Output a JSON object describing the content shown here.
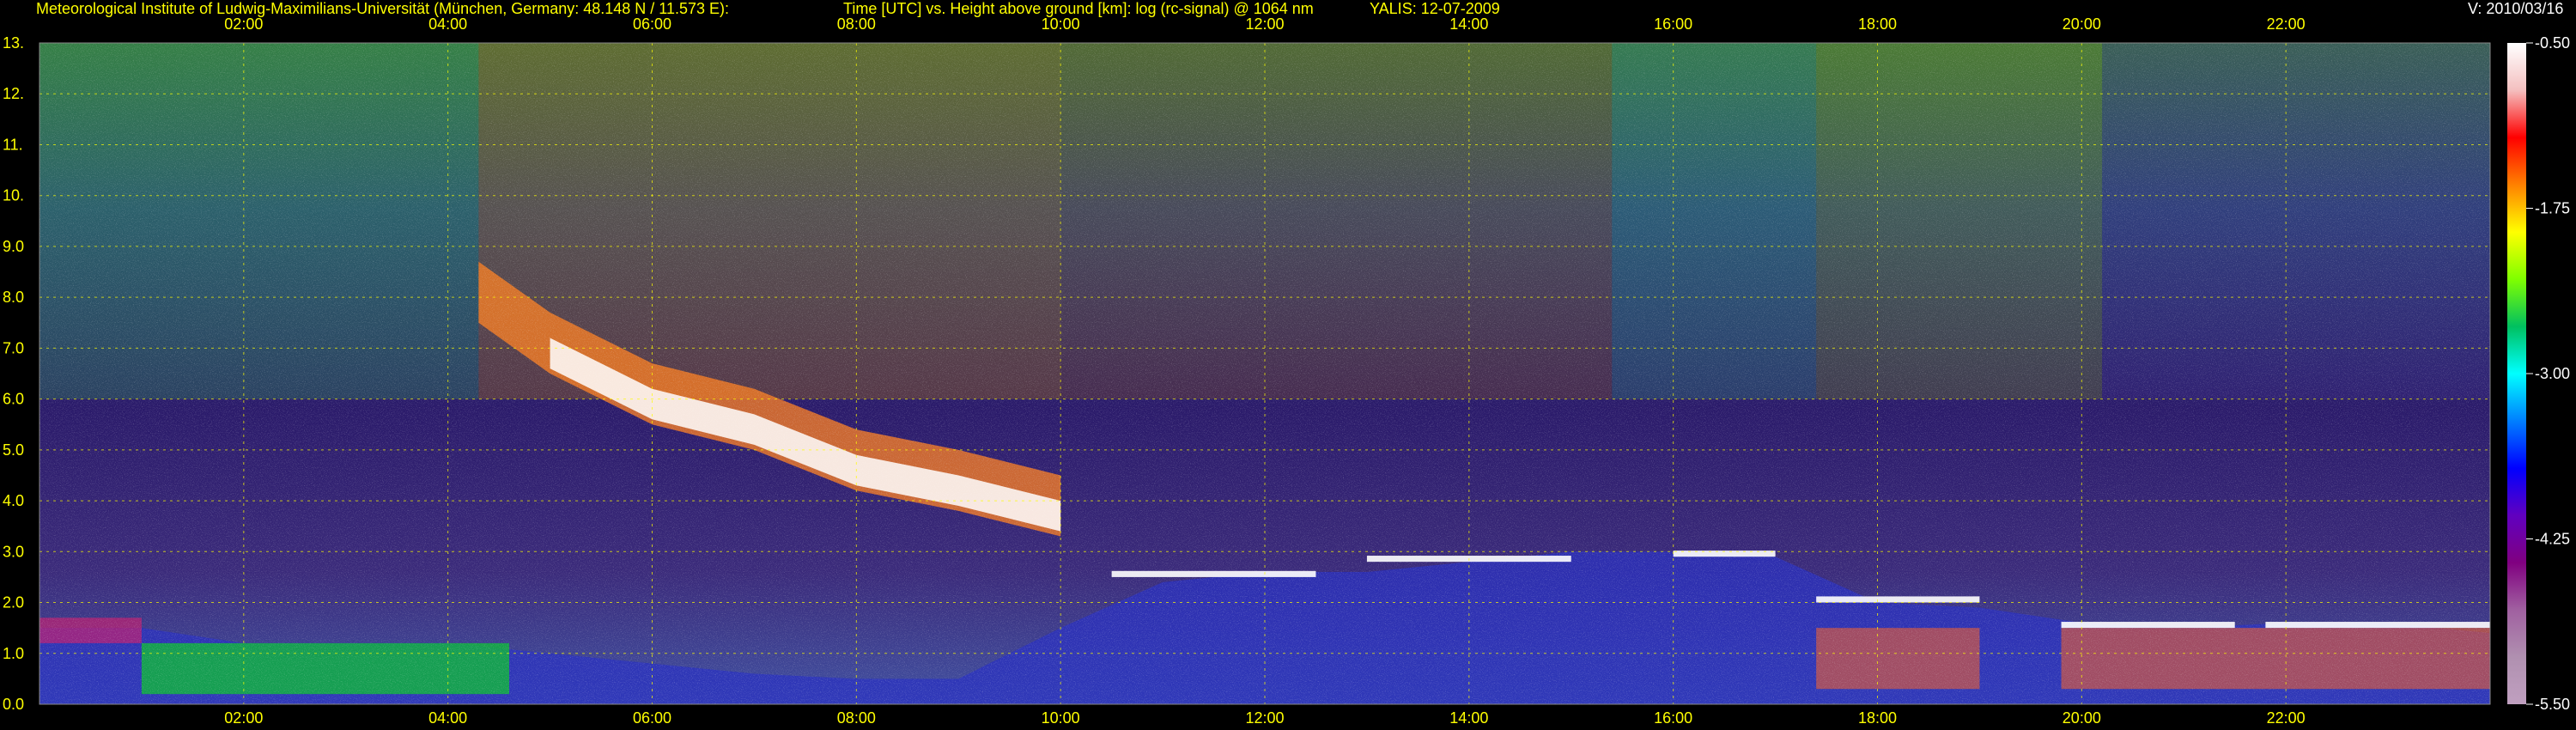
{
  "header": {
    "institute": "Meteorological Institute of Ludwig-Maximilians-Universität (München, Germany: 48.148 N / 11.573 E):",
    "axes_title": "Time [UTC] vs. Height above ground [km]: log (rc-signal) @ 1064 nm",
    "instrument": "YALIS: 12-07-2009",
    "version": "V: 2010/03/16"
  },
  "chart_data": {
    "type": "heatmap",
    "title": "Time [UTC] vs. Height above ground [km]: log (rc-signal) @ 1064 nm",
    "xlabel": "Time [UTC]",
    "ylabel": "Height above ground [km]",
    "xlim": [
      0,
      24
    ],
    "ylim": [
      0,
      13
    ],
    "x_ticks": [
      "02:00",
      "04:00",
      "06:00",
      "08:00",
      "10:00",
      "12:00",
      "14:00",
      "16:00",
      "18:00",
      "20:00",
      "22:00"
    ],
    "x_tick_hours": [
      2,
      4,
      6,
      8,
      10,
      12,
      14,
      16,
      18,
      20,
      22
    ],
    "y_ticks": [
      "0.0",
      "1.0",
      "2.0",
      "3.0",
      "4.0",
      "5.0",
      "6.0",
      "7.0",
      "8.0",
      "9.0",
      "10.",
      "11.",
      "12.",
      "13."
    ],
    "y_tick_values": [
      0,
      1,
      2,
      3,
      4,
      5,
      6,
      7,
      8,
      9,
      10,
      11,
      12,
      13
    ],
    "grid": true,
    "colorbar": {
      "labels": [
        "-0.50",
        "-1.75",
        "-3.00",
        "-4.25",
        "-5.50"
      ],
      "values": [
        -0.5,
        -1.75,
        -3.0,
        -4.25,
        -5.5
      ],
      "colors": [
        "#ffffff",
        "#f4c0c0",
        "#ff0000",
        "#ff8000",
        "#ffff00",
        "#80ff00",
        "#00c060",
        "#00ffff",
        "#0080ff",
        "#0000ff",
        "#6000c0",
        "#800080",
        "#a060a0",
        "#b090b0",
        "#c0a0c0"
      ]
    },
    "features": {
      "boundary_layer_km": {
        "hours": [
          0.0,
          1.0,
          2.0,
          3.0,
          4.0,
          5.0,
          6.0,
          7.0,
          8.0,
          9.0,
          10.0,
          11.0,
          12.0,
          13.0,
          14.0,
          15.0,
          16.0,
          17.0,
          18.0,
          19.0,
          20.0,
          21.0,
          22.0,
          23.0,
          24.0
        ],
        "height": [
          1.5,
          1.5,
          1.2,
          1.2,
          1.2,
          1.0,
          0.8,
          0.6,
          0.5,
          0.5,
          1.5,
          2.4,
          2.6,
          2.6,
          2.8,
          3.0,
          3.0,
          2.9,
          2.0,
          1.9,
          1.6,
          1.5,
          1.6,
          1.6,
          1.4
        ]
      },
      "cirrus_base_km": {
        "hours": [
          4.3,
          5.0,
          6.0,
          7.0,
          8.0,
          9.0,
          10.0
        ],
        "height": [
          7.5,
          6.5,
          5.5,
          5.0,
          4.2,
          3.8,
          3.3
        ]
      }
    }
  }
}
